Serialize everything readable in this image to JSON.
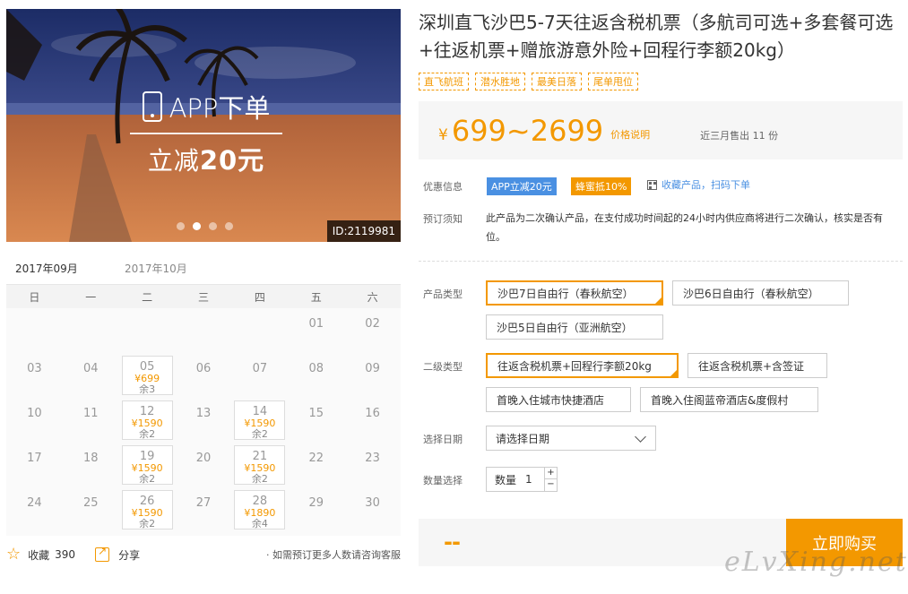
{
  "hero": {
    "promo_line1": "APP下单",
    "promo_line2_prefix": "立减",
    "promo_line2_amount": "20元",
    "image_id": "ID:2119981",
    "slide_count": 4,
    "active_slide": 2
  },
  "calendar": {
    "tabs": [
      {
        "label": "2017年09月",
        "active": true
      },
      {
        "label": "2017年10月",
        "active": false
      }
    ],
    "weekdays": [
      "日",
      "一",
      "二",
      "三",
      "四",
      "五",
      "六"
    ],
    "rows": [
      [
        {
          "d": ""
        },
        {
          "d": ""
        },
        {
          "d": ""
        },
        {
          "d": ""
        },
        {
          "d": ""
        },
        {
          "d": "01"
        },
        {
          "d": "02"
        }
      ],
      [
        {
          "d": "03"
        },
        {
          "d": "04"
        },
        {
          "d": "05",
          "price": "¥699",
          "left": "余3"
        },
        {
          "d": "06"
        },
        {
          "d": "07"
        },
        {
          "d": "08"
        },
        {
          "d": "09"
        }
      ],
      [
        {
          "d": "10"
        },
        {
          "d": "11"
        },
        {
          "d": "12",
          "price": "¥1590",
          "left": "余2"
        },
        {
          "d": "13"
        },
        {
          "d": "14",
          "price": "¥1590",
          "left": "余2"
        },
        {
          "d": "15"
        },
        {
          "d": "16"
        }
      ],
      [
        {
          "d": "17"
        },
        {
          "d": "18"
        },
        {
          "d": "19",
          "price": "¥1590",
          "left": "余2"
        },
        {
          "d": "20"
        },
        {
          "d": "21",
          "price": "¥1590",
          "left": "余2"
        },
        {
          "d": "22"
        },
        {
          "d": "23"
        }
      ],
      [
        {
          "d": "24"
        },
        {
          "d": "25"
        },
        {
          "d": "26",
          "price": "¥1590",
          "left": "余2"
        },
        {
          "d": "27"
        },
        {
          "d": "28",
          "price": "¥1890",
          "left": "余4"
        },
        {
          "d": "29"
        },
        {
          "d": "30"
        }
      ]
    ]
  },
  "actions": {
    "favorite_label": "收藏",
    "favorite_count": "390",
    "share_label": "分享",
    "consult_text": "· 如需预订更多人数请咨询客服"
  },
  "product": {
    "title": "深圳直飞沙巴5-7天往返含税机票（多航司可选+多套餐可选+往返机票+赠旅游意外险+回程行李额20kg）",
    "tags": [
      "直飞航班",
      "潜水胜地",
      "最美日落",
      "尾单甩位"
    ],
    "yen": "¥",
    "price_range": "699~2699",
    "price_explain": "价格说明",
    "sold_text": "近三月售出 11 份"
  },
  "offers": {
    "label": "优惠信息",
    "app_discount": "APP立减20元",
    "honey_discount": "蜂蜜抵10%",
    "qr_link": "收藏产品，扫码下单"
  },
  "booking_notice": {
    "label": "预订须知",
    "text": "此产品为二次确认产品，在支付成功时间起的24小时内供应商将进行二次确认，核实是否有位。"
  },
  "product_type": {
    "label": "产品类型",
    "options": [
      {
        "label": "沙巴7日自由行（春秋航空）",
        "selected": true
      },
      {
        "label": "沙巴6日自由行（春秋航空）",
        "selected": false
      },
      {
        "label": "沙巴5日自由行（亚洲航空）",
        "selected": false
      }
    ]
  },
  "sub_type": {
    "label": "二级类型",
    "options": [
      {
        "label": "往返含税机票+回程行李额20kg",
        "selected": true
      },
      {
        "label": "往返含税机票+含签证",
        "selected": false
      },
      {
        "label": "首晚入住城市快捷酒店",
        "selected": false
      },
      {
        "label": "首晚入住阁蓝帝酒店&度假村",
        "selected": false
      }
    ]
  },
  "date": {
    "label": "选择日期",
    "placeholder": "请选择日期"
  },
  "quantity": {
    "label": "数量选择",
    "field_label": "数量",
    "value": "1",
    "plus": "+",
    "minus": "−"
  },
  "buy": {
    "total": "--",
    "button": "立即购买"
  },
  "watermark": "eLvXing.net",
  "colors": {
    "accent": "#f39800",
    "link": "#4a90e2"
  }
}
